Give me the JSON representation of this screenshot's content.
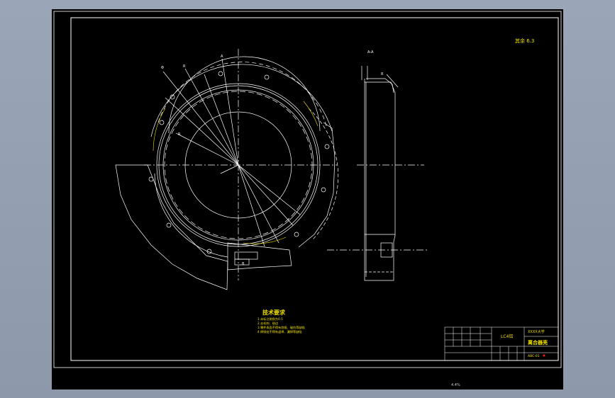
{
  "tech_requirements": {
    "title": "技术要求",
    "items": [
      "1.未标注倒角为0.5",
      "2.去毛刺、锐边",
      "3.零件表面不得有划痕、碰伤等缺陷",
      "4.焊接处不得有虚焊、漏焊等缺陷"
    ]
  },
  "title_block": {
    "material": "LC4铝",
    "company": "XXXX大学",
    "part_name": "离合器壳",
    "drawing_no": "ABC-01"
  },
  "roughness_note": "其余 6.3",
  "bottom_text": "4.4%",
  "colors": {
    "line": "#ffffff",
    "text_yellow": "#f0e000",
    "background": "#000000",
    "accent_red": "#ff2020"
  }
}
